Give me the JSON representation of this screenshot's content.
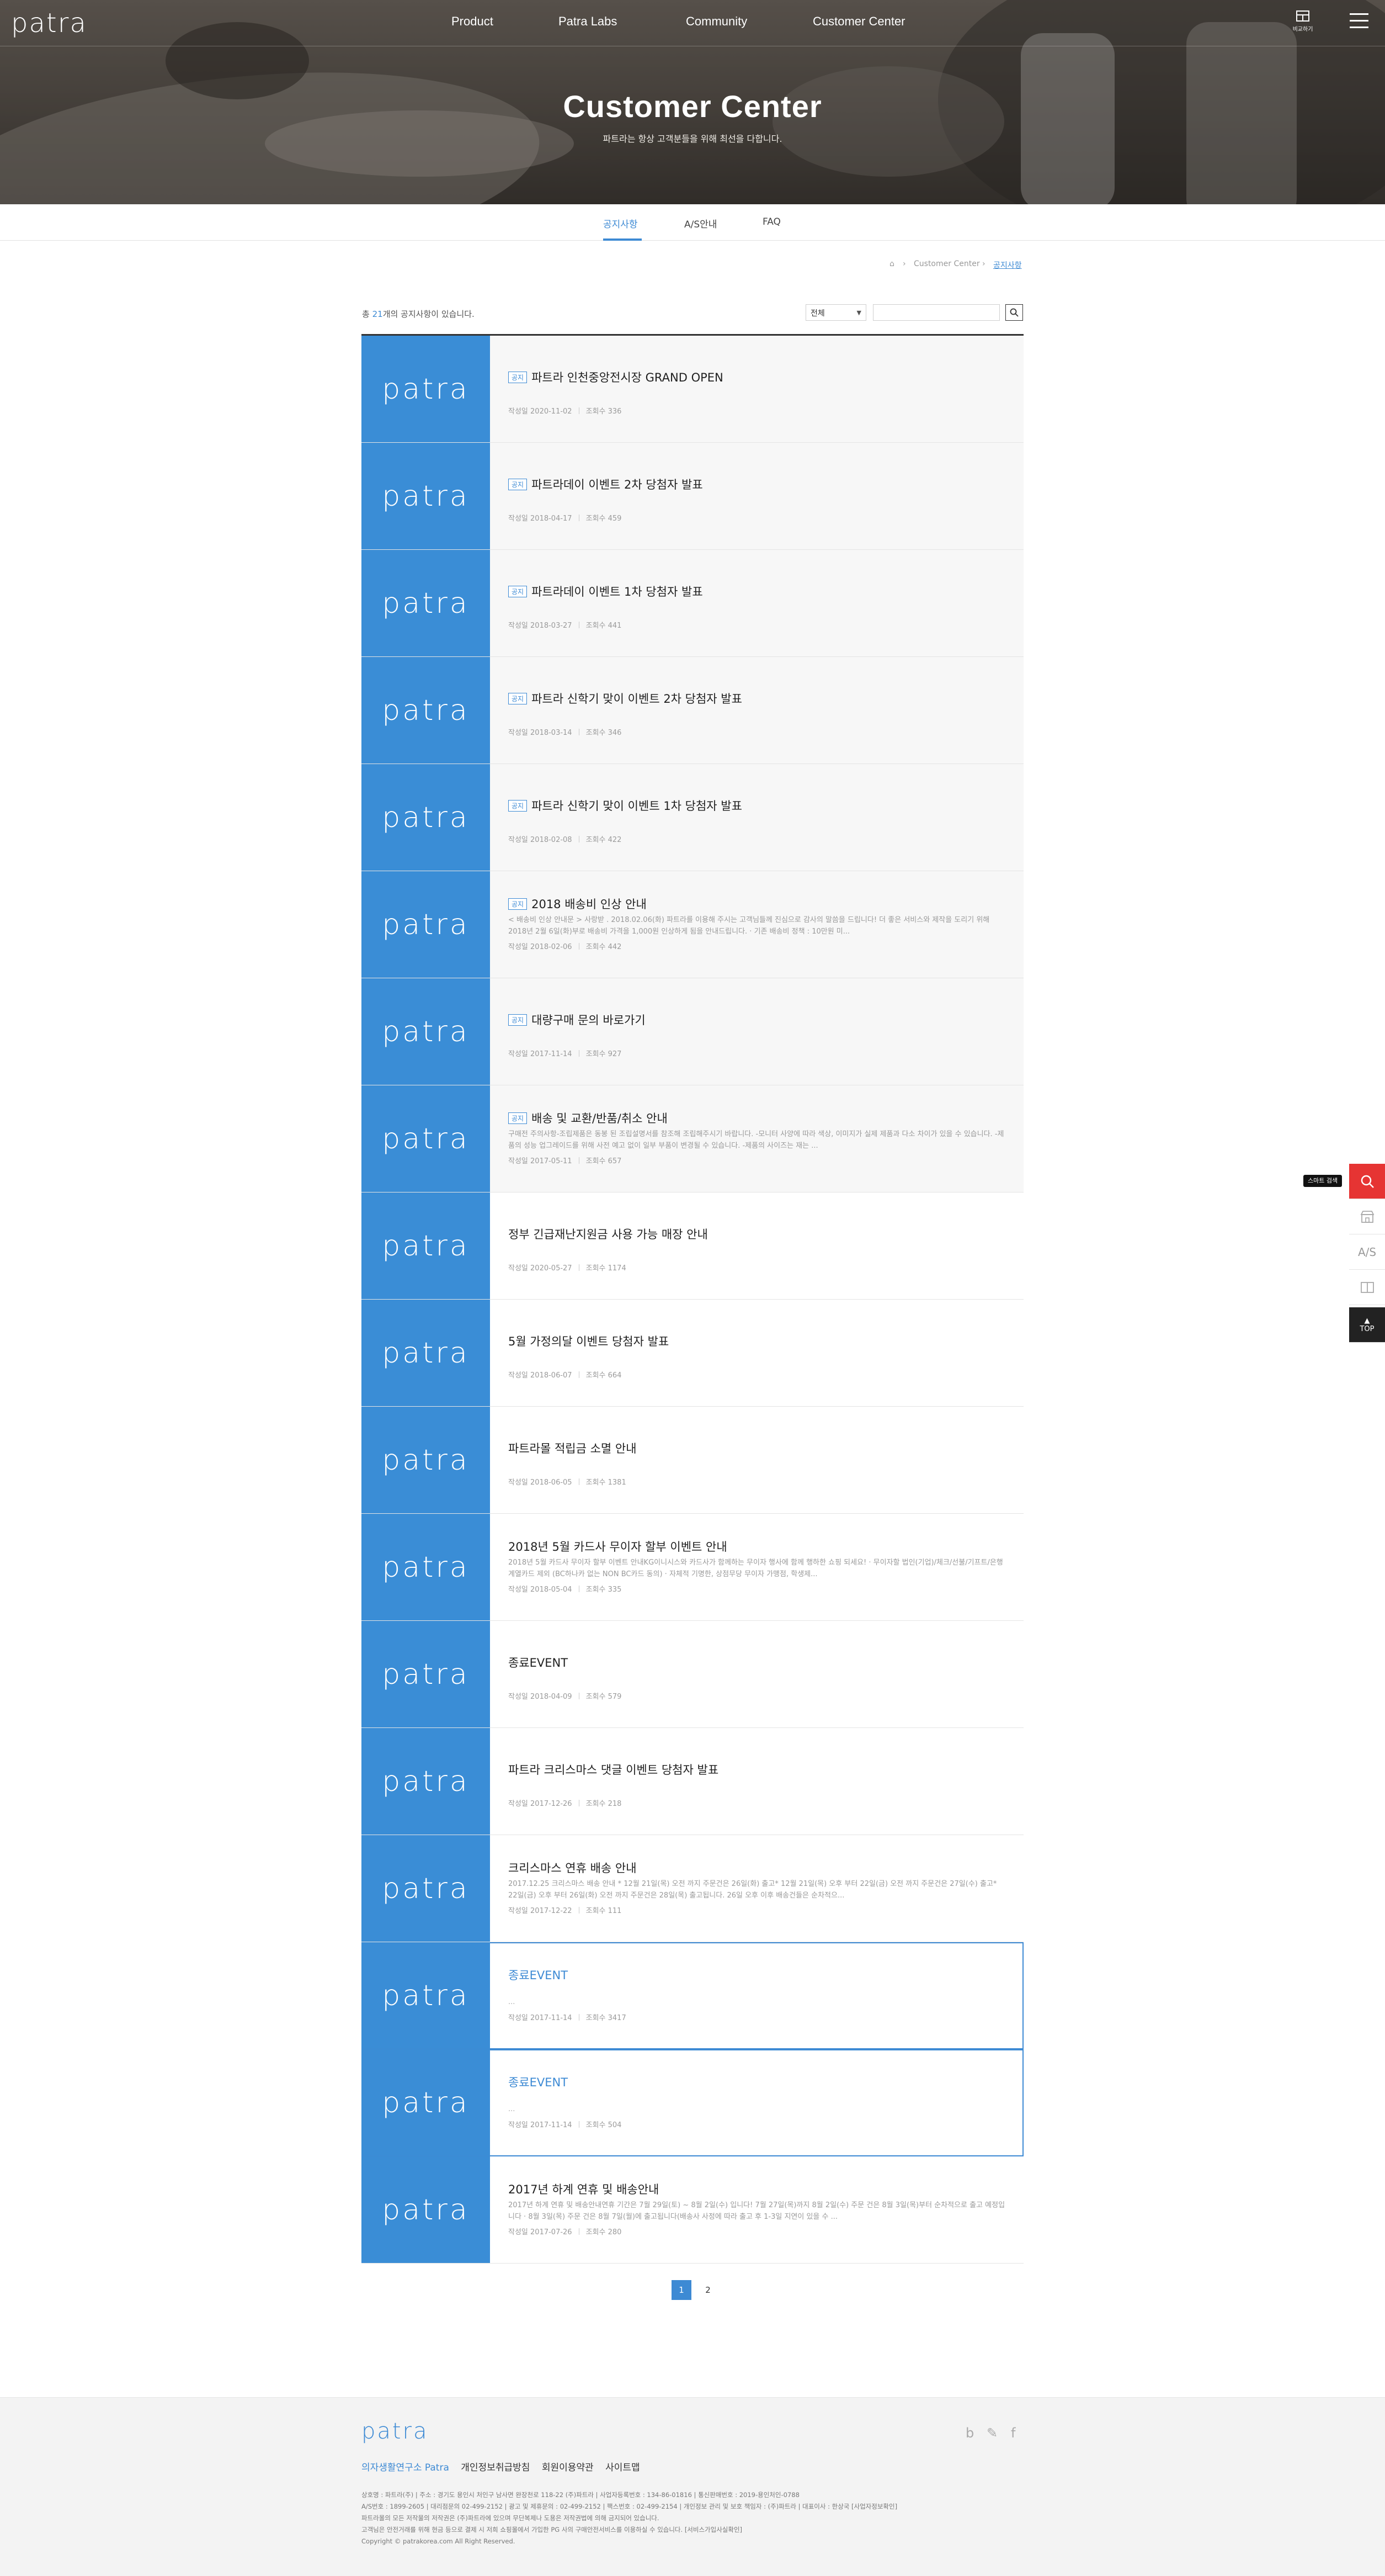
{
  "header": {
    "logo": "patra",
    "nav": [
      "Product",
      "Patra Labs",
      "Community",
      "Customer Center"
    ],
    "compare_label": "비교하기"
  },
  "hero": {
    "title": "Customer Center",
    "subtitle": "파트라는 항상 고객분들을 위해 최선을 다합니다."
  },
  "tabs": [
    "공지사항",
    "A/S안내",
    "FAQ"
  ],
  "breadcrumb": [
    "Customer Center",
    "공지사항"
  ],
  "list_header": {
    "prefix": "총",
    "count": "21",
    "suffix": "개의 공지사항이 있습니다.",
    "filter_value": "전체",
    "search_placeholder": ""
  },
  "meta_labels": {
    "date": "작성일",
    "views": "조회수"
  },
  "notice_badge": "공지",
  "thumb_logo": "patra",
  "items": [
    {
      "title": "파트라 인천중앙전시장 GRAND OPEN",
      "date": "2020-11-02",
      "views": "336",
      "notice": true,
      "summary": ""
    },
    {
      "title": "파트라데이 이벤트 2차 당첨자 발표",
      "date": "2018-04-17",
      "views": "459",
      "notice": true,
      "summary": ""
    },
    {
      "title": "파트라데이 이벤트 1차 당첨자 발표",
      "date": "2018-03-27",
      "views": "441",
      "notice": true,
      "summary": ""
    },
    {
      "title": "파트라 신학기 맞이 이벤트 2차 당첨자 발표",
      "date": "2018-03-14",
      "views": "346",
      "notice": true,
      "summary": ""
    },
    {
      "title": "파트라 신학기 맞이 이벤트 1차 당첨자 발표",
      "date": "2018-02-08",
      "views": "422",
      "notice": true,
      "summary": ""
    },
    {
      "title": "2018 배송비 인상 안내",
      "date": "2018-02-06",
      "views": "442",
      "notice": true,
      "summary": "< 배송비 인상 안내문 > 사랑받 . 2018.02.06(화) 파트라를 이용해 주시는 고객님들께 진심으로 감사의 말씀을 드립니다! 더 좋은 서비스와 제작을 도리기 위해 2018년 2월 6일(화)부로 배송비 가격을 1,000원 인상하게 됨을 안내드립니다. · 기존 배송비 정책 : 10만원 미..."
    },
    {
      "title": "대량구매 문의 바로가기",
      "date": "2017-11-14",
      "views": "927",
      "notice": true,
      "summary": ""
    },
    {
      "title": "배송 및 교환/반품/취소 안내",
      "date": "2017-05-11",
      "views": "657",
      "notice": true,
      "summary": "구매전 주의사항-조립제품은 동봉 된 조립설명서를 참조해 조립해주시기 바랍니다. -모니터 사양에 따라 색상, 이미지가 실제 제품과 다소 차이가 있을 수 있습니다. -제품의 성능 업그레이드를 위해 사전 예고 없이 일부 부품이 변경될 수 있습니다. -제품의 사이즈는 재는 ..."
    },
    {
      "title": "정부 긴급재난지원금 사용 가능 매장 안내",
      "date": "2020-05-27",
      "views": "1174",
      "notice": false,
      "summary": ""
    },
    {
      "title": "5월 가정의달 이벤트 당첨자 발표",
      "date": "2018-06-07",
      "views": "664",
      "notice": false,
      "summary": ""
    },
    {
      "title": "파트라몰 적립금 소멸 안내",
      "date": "2018-06-05",
      "views": "1381",
      "notice": false,
      "summary": ""
    },
    {
      "title": "2018년 5월 카드사 무이자 할부 이벤트 안내",
      "date": "2018-05-04",
      "views": "335",
      "notice": false,
      "summary": "2018년 5월 카드사 무이자 할부 이벤트 안내KG이니시스와 카드사가 함께하는 무이자 행사에 함께 행하한 쇼핑 되세요! · 무이자할 법인(기업)/체크/선불/기프트/은행계열카드 제외 (BC하나카 없는 NON BC카드 동의) · 자체적 기명한, 상점무당 무이자 가맹점, 학생제..."
    },
    {
      "title": "종료EVENT",
      "date": "2018-04-09",
      "views": "579",
      "notice": false,
      "summary": ""
    },
    {
      "title": "파트라 크리스마스 댓글 이벤트 당첨자 발표",
      "date": "2017-12-26",
      "views": "218",
      "notice": false,
      "summary": ""
    },
    {
      "title": "크리스마스 연휴 배송 안내",
      "date": "2017-12-22",
      "views": "111",
      "notice": false,
      "summary": "2017.12.25 크리스마스 배송 안내 * 12월 21일(목) 오전 까지 주문건은 26일(화) 출고* 12월 21일(목) 오후 부터 22일(금) 오전 까지 주문건은 27일(수) 출고* 22일(금) 오후 부터 26일(화) 오전 까지 주문건은 28일(목) 출고됩니다.  26일 오후 이후 배송건들은 순차적으..."
    },
    {
      "title": "종료EVENT",
      "date": "2017-11-14",
      "views": "3417",
      "notice": false,
      "summary": "...",
      "highlight": true
    },
    {
      "title": "종료EVENT",
      "date": "2017-11-14",
      "views": "504",
      "notice": false,
      "summary": "...",
      "highlight": true
    },
    {
      "title": "2017년 하계 연휴 및 배송안내",
      "date": "2017-07-26",
      "views": "280",
      "notice": false,
      "summary": "2017년 하계 연휴 및 배송안내연휴 기간은 7월 29일(토) ~ 8월 2일(수) 입니다! 7월 27일(목)까지 8월 2일(수) 주문 건은 8월 3일(목)부터 순차적으로 출고 예정입니다 · 8월 3일(목) 주문 건은 8월 7일(월)에 출고됩니다(배송사 사정에 따라 출고 후 1-3일 지연이 있을 수 ..."
    }
  ],
  "pagination": {
    "pages": [
      "1",
      "2"
    ],
    "current": "1"
  },
  "quick_menu": {
    "tooltip": "스마트 검색",
    "as_label": "A/S",
    "top_label": "TOP"
  },
  "footer": {
    "logo": "patra",
    "links": [
      "의자생활연구소 Patra",
      "개인정보취급방침",
      "회원이용약관",
      "사이트맵"
    ],
    "sns": [
      "b",
      "✎",
      "f"
    ],
    "info_lines": [
      "상호명 : 파트라(주)    |    주소 : 경기도 용인시 처인구 남사면 완장천로 118-22 (주)파트라    |    사업자등록번호 : 134-86-01816    |    통신판매번호 : 2019-용인처인-0788",
      "A/S번호 : 1899-2605    |    대리점문의 02-499-2152    |    광고 및 제휴문의 : 02-499-2152    |    팩스번호 : 02-499-2154    |    개인정보 관리 및 보호 책임자 : (주)파트라    |    대표이사 : 한상국 [사업자정보확인]",
      "파트라몰의 모든 저작물의 저작권은 (주)파트라에 있으며 무단복제나 도용은 저작권법에 의해 금지되어 있습니다.",
      "고객님은 안전거래를 위해 현금 등으로 결제 시 저희 쇼핑몰에서 가입한 PG 사의 구매안전서비스를 이용하실 수 있습니다. [서비스가입사실확인]",
      "Copyright © patrakorea.com All Right Reserved."
    ]
  },
  "colors": {
    "brand_blue": "#3d8ad4",
    "thumb_blue": "#3a8dd6",
    "quick_red": "#e63433"
  }
}
